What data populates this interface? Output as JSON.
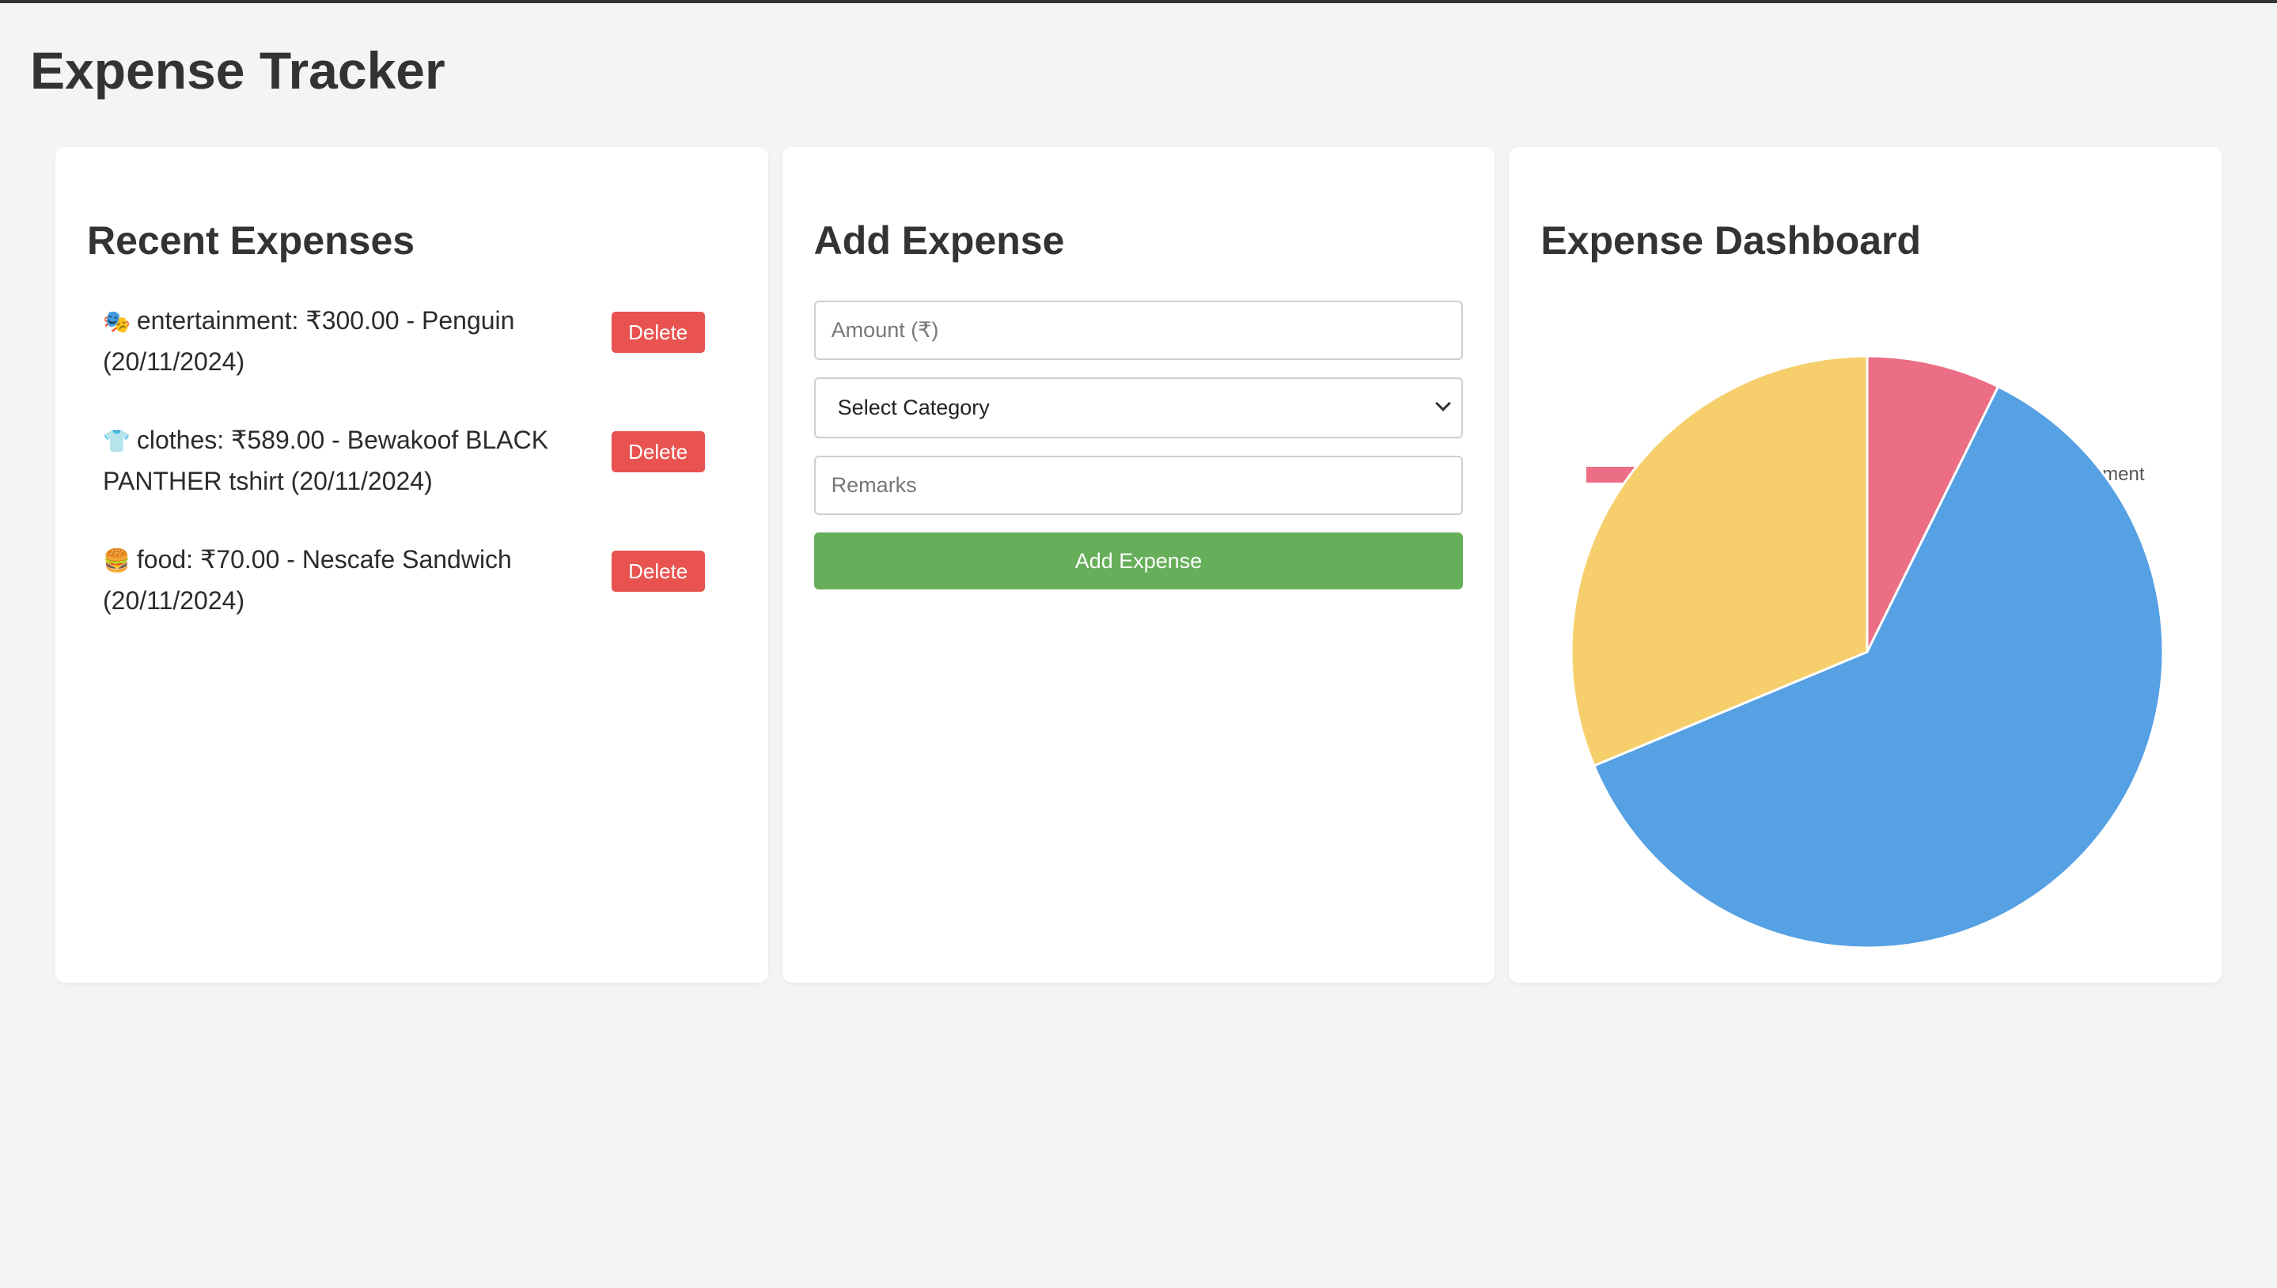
{
  "app": {
    "title": "Expense Tracker"
  },
  "recent": {
    "title": "Recent Expenses",
    "items": [
      {
        "icon": "🎭",
        "icon_name": "theater-masks-icon",
        "text": "entertainment: ₹300.00 - Penguin (20/11/2024)",
        "delete_label": "Delete"
      },
      {
        "icon": "👕",
        "icon_name": "tshirt-icon",
        "text": "clothes: ₹589.00 - Bewakoof BLACK PANTHER tshirt (20/11/2024)",
        "delete_label": "Delete"
      },
      {
        "icon": "🍔",
        "icon_name": "burger-icon",
        "text": "food: ₹70.00 - Nescafe Sandwich (20/11/2024)",
        "delete_label": "Delete"
      }
    ]
  },
  "form": {
    "title": "Add Expense",
    "amount_placeholder": "Amount (₹)",
    "amount_value": "",
    "category_selected": "Select Category",
    "remarks_placeholder": "Remarks",
    "remarks_value": "",
    "submit_label": "Add Expense"
  },
  "dashboard": {
    "title": "Expense Dashboard"
  },
  "chart_data": {
    "type": "pie",
    "title": "",
    "categories": [
      "🍔 food",
      "👕 clothes",
      "🎭 entertainment"
    ],
    "category_icons": [
      "burger-icon",
      "tshirt-icon",
      "theater-masks-icon"
    ],
    "category_text": [
      "food",
      "clothes",
      "entertainment"
    ],
    "values": [
      70,
      589,
      300
    ],
    "colors": [
      "#ec6e85",
      "#56a0e4",
      "#f6cf6c"
    ],
    "legend_position": "top"
  }
}
